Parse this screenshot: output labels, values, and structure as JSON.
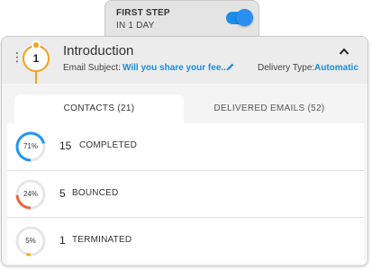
{
  "step": {
    "title": "FIRST STEP",
    "subtitle": "IN 1 DAY",
    "toggle_on": true
  },
  "header": {
    "step_number": "1",
    "title": "Introduction",
    "subject_label": "Email Subject:",
    "subject_value": "Will you share your fee...",
    "delivery_label": "Delivery Type:",
    "delivery_value": "Automatic"
  },
  "tabs": [
    {
      "label": "CONTACTS (21)",
      "active": true
    },
    {
      "label": "DELIVERED EMAILS (52)",
      "active": false
    }
  ],
  "stats": [
    {
      "percent_label": "71%",
      "percent": 71,
      "count": "15",
      "label": "COMPLETED",
      "color": "#2196f3"
    },
    {
      "percent_label": "24%",
      "percent": 24,
      "count": "5",
      "label": "BOUNCED",
      "color": "#e8663d"
    },
    {
      "percent_label": "5%",
      "percent": 5,
      "count": "1",
      "label": "TERMINATED",
      "color": "#f5b301"
    }
  ],
  "colors": {
    "accent": "#1a8ddd",
    "step_orange": "#f0a21b",
    "toggle": "#1b8ee8"
  }
}
